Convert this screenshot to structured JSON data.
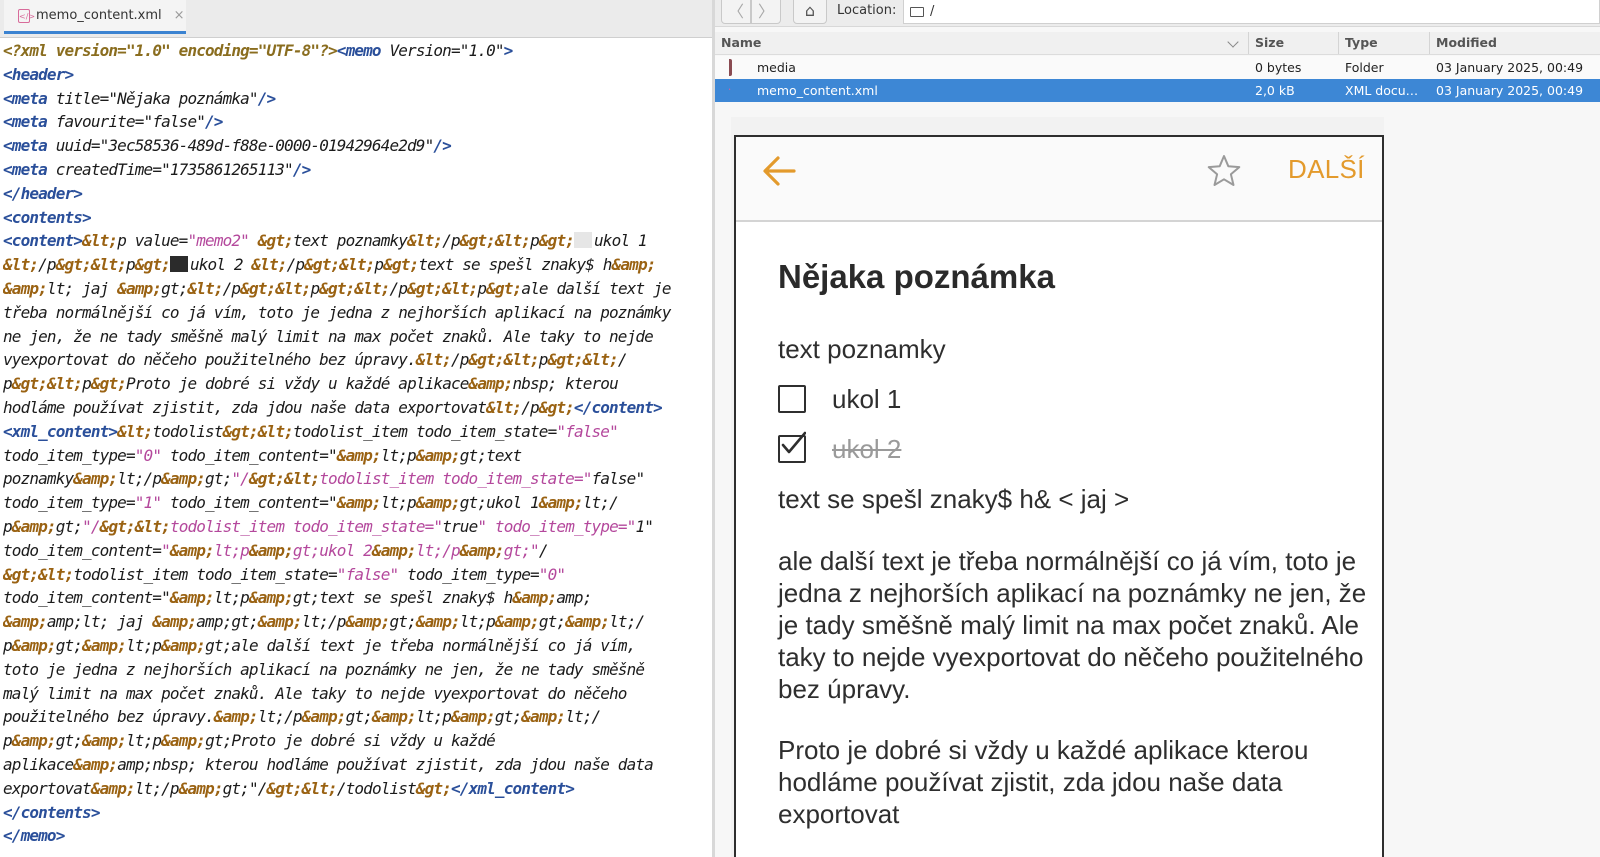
{
  "editor": {
    "tab_label": "memo_content.xml",
    "tab_close": "×",
    "tab_icon": "</>",
    "checkbox_off_glyph": "⬜",
    "checkbox_on_glyph": "⬛",
    "lines": [
      "<?xml version=\"1.0\" encoding=\"UTF-8\"?><memo Version=\"1.0\">",
      "<header>",
      "<meta title=\"Nějaka poznámka\"/>",
      "<meta favourite=\"false\"/>",
      "<meta uuid=\"3ec58536-489d-f88e-0000-01942964e2d9\"/>",
      "<meta createdTime=\"1735861265113\"/>",
      "</header>",
      "<contents>",
      "<content>&lt;p value=\"memo2\" &gt;text poznamky&lt;/p&gt;&lt;p&gt;⬜ukol 1",
      "&lt;/p&gt;&lt;p&gt;⬛ukol 2 &lt;/p&gt;&lt;p&gt;text se spešl znaky$ h&amp;",
      "&amp;lt; jaj &amp;gt;&lt;/p&gt;&lt;p&gt;&lt;/p&gt;&lt;p&gt;ale další text je",
      "třeba normálnější co já vím, toto je jedna z nejhorších aplikací na poznámky",
      "ne jen, že ne tady směšně malý limit na max počet znaků. Ale taky to nejde",
      "vyexportovat do něčeho použitelného bez úpravy.&lt;/p&gt;&lt;p&gt;&lt;/",
      "p&gt;&lt;p&gt;Proto je dobré si vždy u každé aplikace&amp;nbsp; kterou",
      "hodláme používat zjistit, zda jdou naše data exportovat&lt;/p&gt;</content>",
      "<xml_content>&lt;todolist&gt;&lt;todolist_item todo_item_state=\"false\"",
      "todo_item_type=\"0\" todo_item_content=\"&amp;lt;p&amp;gt;text",
      "poznamky&amp;lt;/p&amp;gt;\"/&gt;&lt;todolist_item todo_item_state=\"false\"",
      "todo_item_type=\"1\" todo_item_content=\"&amp;lt;p&amp;gt;ukol 1&amp;lt;/",
      "p&amp;gt;\"/&gt;&lt;todolist_item todo_item_state=\"true\" todo_item_type=\"1\"",
      "todo_item_content=\"&amp;lt;p&amp;gt;ukol 2&amp;lt;/p&amp;gt;\"/",
      "&gt;&lt;todolist_item todo_item_state=\"false\" todo_item_type=\"0\"",
      "todo_item_content=\"&amp;lt;p&amp;gt;text se spešl znaky$ h&amp;amp;",
      "&amp;amp;lt; jaj &amp;amp;gt;&amp;lt;/p&amp;gt;&amp;lt;p&amp;gt;&amp;lt;/",
      "p&amp;gt;&amp;lt;p&amp;gt;ale další text je třeba normálnější co já vím,",
      "toto je jedna z nejhorších aplikací na poznámky ne jen, že ne tady směšně",
      "malý limit na max počet znaků. Ale taky to nejde vyexportovat do něčeho",
      "použitelného bez úpravy.&amp;lt;/p&amp;gt;&amp;lt;p&amp;gt;&amp;lt;/",
      "p&amp;gt;&amp;lt;p&amp;gt;Proto je dobré si vždy u každé",
      "aplikace&amp;amp;nbsp; kterou hodláme používat zjistit, zda jdou naše data",
      "exportovat&amp;lt;/p&amp;gt;\"/&gt;&lt;/todolist&gt;</xml_content>",
      "</contents>",
      "</memo>"
    ]
  },
  "file_manager": {
    "location_label": "Location:",
    "location_path": "/",
    "back_glyph": "〈",
    "forward_glyph": "〉",
    "home_glyph": "⌂",
    "columns": {
      "name": "Name",
      "size": "Size",
      "type": "Type",
      "modified": "Modified"
    },
    "files": [
      {
        "name": "media",
        "size": "0 bytes",
        "type": "Folder",
        "modified": "03 January 2025, 00:49",
        "icon": "folder-icon"
      },
      {
        "name": "memo_content.xml",
        "size": "2,0 kB",
        "type": "XML document",
        "modified": "03 January 2025, 00:49",
        "icon": "xml-file-icon"
      }
    ],
    "selected_color": "#3d87d5"
  },
  "preview": {
    "action_label": "DALŠÍ",
    "accent_color": "#e39a2c",
    "title": "Nějaka poznámka",
    "text1": "text poznamky",
    "todos": [
      {
        "label": "ukol 1",
        "checked": false
      },
      {
        "label": "ukol 2",
        "checked": true
      }
    ],
    "text2": "text se spešl znaky$ h& < jaj >",
    "paragraph1": "ale další text je třeba normálnější co já vím, toto je jedna z nejhorších aplikací na poznámky ne jen, že je tady směšně malý limit na max počet znaků. Ale taky to nejde vyexportovat do něčeho použitelného bez úpravy.",
    "paragraph2": "Proto je dobré si vždy u každé aplikace  kterou hodláme používat zjistit, zda jdou naše data exportovat"
  }
}
